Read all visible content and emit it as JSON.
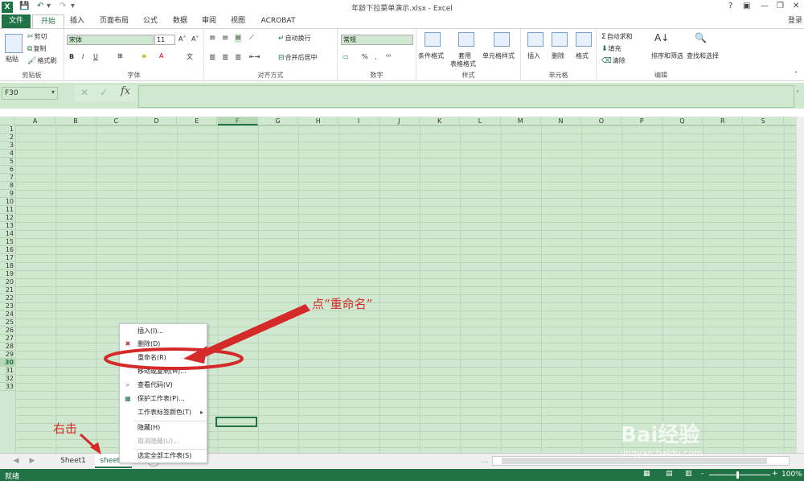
{
  "titlebar": {
    "title": "年龄下拉菜单演示.xlsx - Excel",
    "logo": "X",
    "help": "?",
    "ribbon_opt": "▣",
    "min": "—",
    "restore": "❐",
    "close": "✕"
  },
  "tabs": {
    "file": "文件",
    "home": "开始",
    "insert": "插入",
    "layout": "页面布局",
    "formulas": "公式",
    "data": "数据",
    "review": "审阅",
    "view": "视图",
    "acrobat": "ACROBAT",
    "login": "登录"
  },
  "ribbon": {
    "clipboard": {
      "paste": "粘贴",
      "cut": "剪切",
      "copy": "复制",
      "format_painter": "格式刷",
      "label": "剪贴板"
    },
    "font": {
      "name": "宋体",
      "size": "11",
      "bold": "B",
      "italic": "I",
      "underline": "U",
      "grow": "A˄",
      "shrink": "A˅",
      "label": "字体"
    },
    "align": {
      "wrap": "自动换行",
      "merge": "合并后居中",
      "label": "对齐方式"
    },
    "number": {
      "format": "常规",
      "percent": "%",
      "comma": ",",
      "label": "数字"
    },
    "styles": {
      "cond": "条件格式",
      "table1": "套用",
      "table2": "表格格式",
      "cell": "单元格样式",
      "label": "样式"
    },
    "cells": {
      "insert": "插入",
      "delete": "删除",
      "format": "格式",
      "label": "单元格"
    },
    "editing": {
      "autosum": "自动求和",
      "fill": "填充",
      "clear": "清除",
      "sort": "排序和筛选",
      "find": "查找和选择",
      "label": "编辑"
    }
  },
  "formula_bar": {
    "name_box": "F30",
    "cancel": "✕",
    "enter": "✓",
    "fx": "fx",
    "value": ""
  },
  "columns": [
    "A",
    "B",
    "C",
    "D",
    "E",
    "F",
    "G",
    "H",
    "I",
    "J",
    "K",
    "L",
    "M",
    "N",
    "O",
    "P",
    "Q",
    "R",
    "S"
  ],
  "rows": [
    "1",
    "2",
    "3",
    "4",
    "5",
    "6",
    "7",
    "8",
    "9",
    "10",
    "11",
    "12",
    "13",
    "14",
    "15",
    "16",
    "17",
    "18",
    "19",
    "20",
    "21",
    "22",
    "23",
    "24",
    "25",
    "26",
    "27",
    "28",
    "29",
    "30",
    "31",
    "32",
    "33"
  ],
  "selected": {
    "column": "F",
    "row": "30"
  },
  "sheets": {
    "s1": "Sheet1",
    "s2": "sheet...",
    "add": "+",
    "nav_prev": "◀",
    "nav_next": "▶",
    "more": "..."
  },
  "context_menu": {
    "insert": "插入(I)...",
    "delete": "删除(D)",
    "rename": "重命名(R)",
    "move_copy": "移动或复制(M)...",
    "view_code": "查看代码(V)",
    "protect": "保护工作表(P)...",
    "tab_color": "工作表标签颜色(T)",
    "hide": "隐藏(H)",
    "unhide": "取消隐藏(U)...",
    "select_all": "选定全部工作表(S)"
  },
  "status": {
    "ready": "就绪",
    "zoom": "100%",
    "minus": "-",
    "plus": "+"
  },
  "annotations": {
    "click_rename": "点“重命名”",
    "right_click": "右击"
  },
  "watermark": {
    "brand": "Bai经验",
    "url": "jingyan.baidu.com"
  },
  "colors": {
    "excel_green": "#217346",
    "grid_green": "#cfe8cf",
    "annotation_red": "#d42a2a"
  }
}
